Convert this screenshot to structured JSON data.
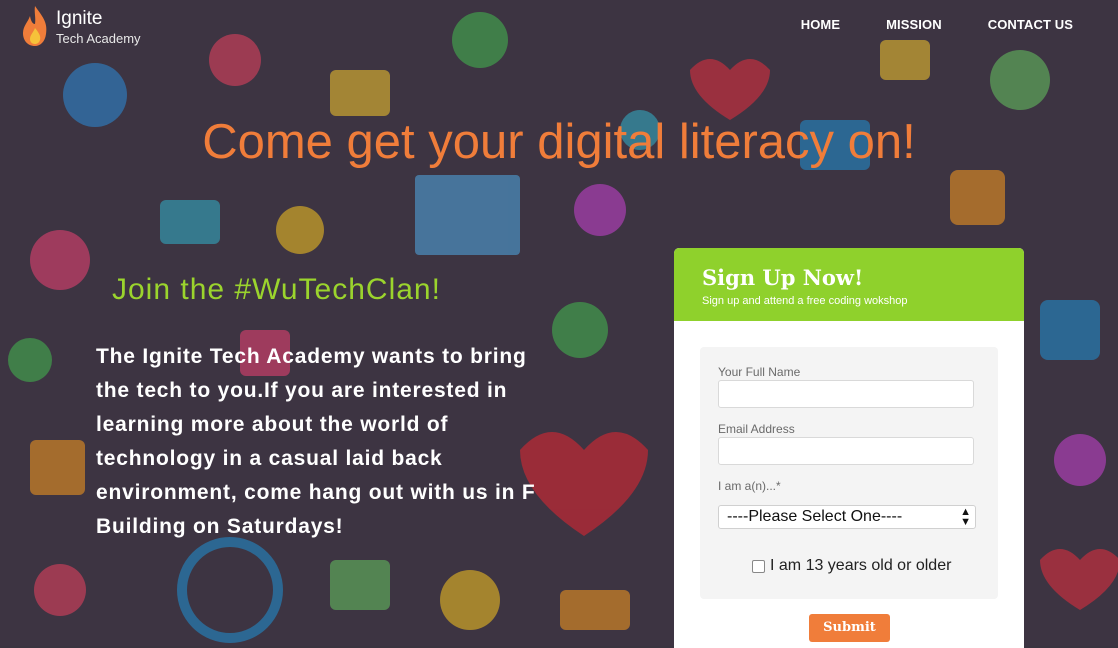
{
  "brand": {
    "name": "Ignite",
    "tagline": "Tech Academy",
    "flame_icon": "flame-icon"
  },
  "nav": {
    "items": [
      "HOME",
      "MISSION",
      "CONTACT US"
    ]
  },
  "hero": {
    "headline": "Come get your digital literacy on!",
    "subhead": "Join the #WuTechClan!",
    "body": "The Ignite Tech Academy wants to bring the tech to you.If you are interested in learning more about the world of technology in a casual laid back environment, come hang out with us in F Building on Saturdays!"
  },
  "signup": {
    "title": "Sign Up Now!",
    "subtitle": "Sign up and attend a free coding wokshop",
    "name_label": "Your Full Name",
    "email_label": "Email Address",
    "role_label": "I am a(n)...*",
    "role_selected": "----Please Select One----",
    "age_check_label": "I am 13 years old or older",
    "submit_label": "Submit"
  },
  "colors": {
    "accent_orange": "#f07d3a",
    "accent_green": "#8fd12c",
    "subhead_green": "#9bd42d"
  }
}
